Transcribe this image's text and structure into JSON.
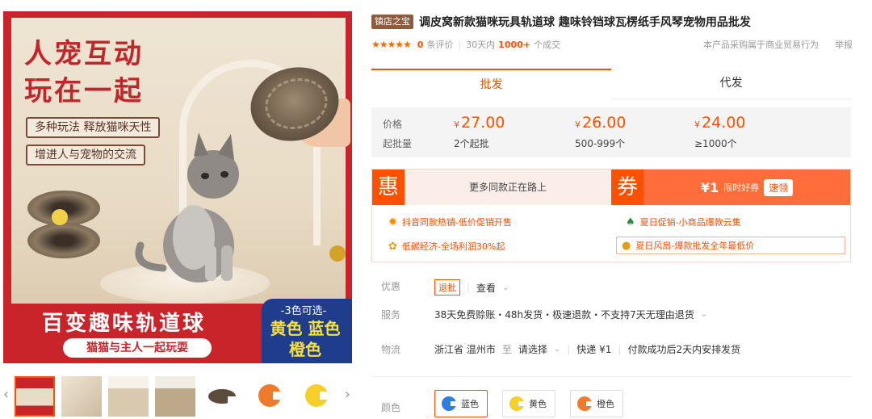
{
  "image": {
    "headline_1": "人宠互动",
    "headline_2": "玩在一起",
    "tag_1": "多种玩法 释放猫咪天性",
    "tag_2": "增进人与宠物的交流",
    "banner_title": "百变趣味轨道球",
    "banner_sub": "猫猫与主人一起玩耍",
    "colors_head": "-3色可选-",
    "colors_line1": "黄色 蓝色",
    "colors_line2": "橙色"
  },
  "thumbnails": {
    "prev_arrow": "‹",
    "next_arrow": "›",
    "items": [
      {
        "kind": "photo",
        "color": "#c8242a"
      },
      {
        "kind": "photo",
        "color": "#e9dcc6"
      },
      {
        "kind": "photo",
        "color": "#f1ece3"
      },
      {
        "kind": "photo",
        "color": "#e8e0d2"
      },
      {
        "kind": "product",
        "color": "#5b4b3b"
      },
      {
        "kind": "product",
        "color": "#f07a2c"
      },
      {
        "kind": "product",
        "color": "#f6cf2b"
      }
    ]
  },
  "product": {
    "badge": "镇店之宝",
    "title": "调皮窝新款猫咪玩具轨道球 趣味铃铛球瓦楞纸手风琴宠物用品批发",
    "stars": "★★★★★",
    "review_count": "0",
    "review_label": "条评价",
    "period": "30天内",
    "deals_count": "1000+",
    "deals_label": "个成交",
    "notice": "本产品采购属于商业贸易行为",
    "report": "举报"
  },
  "tabs": [
    {
      "label": "批发",
      "active": true
    },
    {
      "label": "代发",
      "active": false
    }
  ],
  "pricing": {
    "price_label": "价格",
    "moq_label": "起批量",
    "currency": "¥",
    "tiers": [
      {
        "price": "27.00",
        "moq": "2个起批"
      },
      {
        "price": "26.00",
        "moq": "500-999个"
      },
      {
        "price": "24.00",
        "moq": "≥1000个"
      }
    ]
  },
  "promo": {
    "hui": "惠",
    "hui_text": "更多同款正在路上",
    "quan": "券",
    "coupon_amount": "¥1",
    "coupon_limit": "限时好券",
    "coupon_button": "速领",
    "items": [
      {
        "icon": "sun-icon",
        "text": "抖音同款热销-低价促销开售"
      },
      {
        "icon": "leaf-icon",
        "text": "夏日促销-小商品爆款云集"
      },
      {
        "icon": "flower-icon",
        "text": "低碳经济-全场利润30%起"
      },
      {
        "icon": "cat-face-icon",
        "text": "夏日风扇-爆款批发全年最低价"
      }
    ]
  },
  "rows": {
    "discount_label": "优惠",
    "discount_tag": "退批",
    "discount_view": "查看",
    "service_label": "服务",
    "service_text": "38天免费赊账・48h发货・极速退款・不支持7天无理由退货",
    "logistics_label": "物流",
    "origin": "浙江省 温州市",
    "to": "至",
    "destination": "请选择",
    "express": "快递 ¥1",
    "ship_note": "付款成功后2天内安排发货",
    "color_label": "颜色"
  },
  "color_options": [
    {
      "name": "蓝色",
      "hex": "#2d7fe0",
      "selected": true
    },
    {
      "name": "黄色",
      "hex": "#f6cf2b",
      "selected": false
    },
    {
      "name": "橙色",
      "hex": "#f07a2c",
      "selected": false
    }
  ]
}
